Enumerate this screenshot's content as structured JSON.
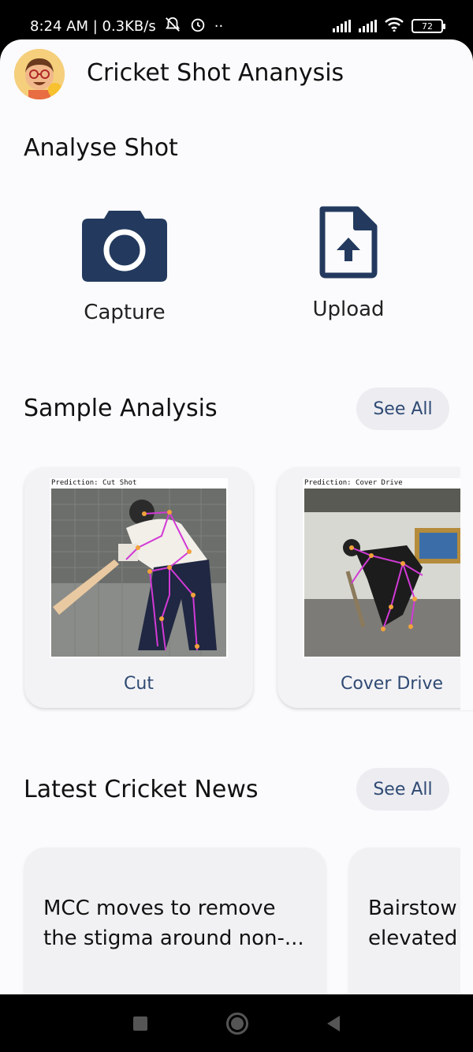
{
  "status_bar": {
    "time_speed": "8:24 AM | 0.3KB/s",
    "extra": "··",
    "battery": "72"
  },
  "header": {
    "title": "Cricket Shot Ananysis",
    "avatar_icon": "cartoon-avatar-icon"
  },
  "analyse": {
    "title": "Analyse Shot",
    "capture_label": "Capture",
    "upload_label": "Upload",
    "icon_color": "#233a5e"
  },
  "samples": {
    "title": "Sample Analysis",
    "see_all": "See All",
    "items": [
      {
        "prediction": "Prediction:   Cut Shot",
        "label": "Cut"
      },
      {
        "prediction": "Prediction:   Cover Drive",
        "label": "Cover Drive"
      }
    ]
  },
  "news": {
    "title": "Latest Cricket News",
    "see_all": "See All",
    "items": [
      {
        "headline_line1": "MCC moves to remove",
        "headline_line2": "the stigma around non-..."
      },
      {
        "headline_line1": "Bairstow",
        "headline_line2": "elevated s"
      }
    ]
  }
}
